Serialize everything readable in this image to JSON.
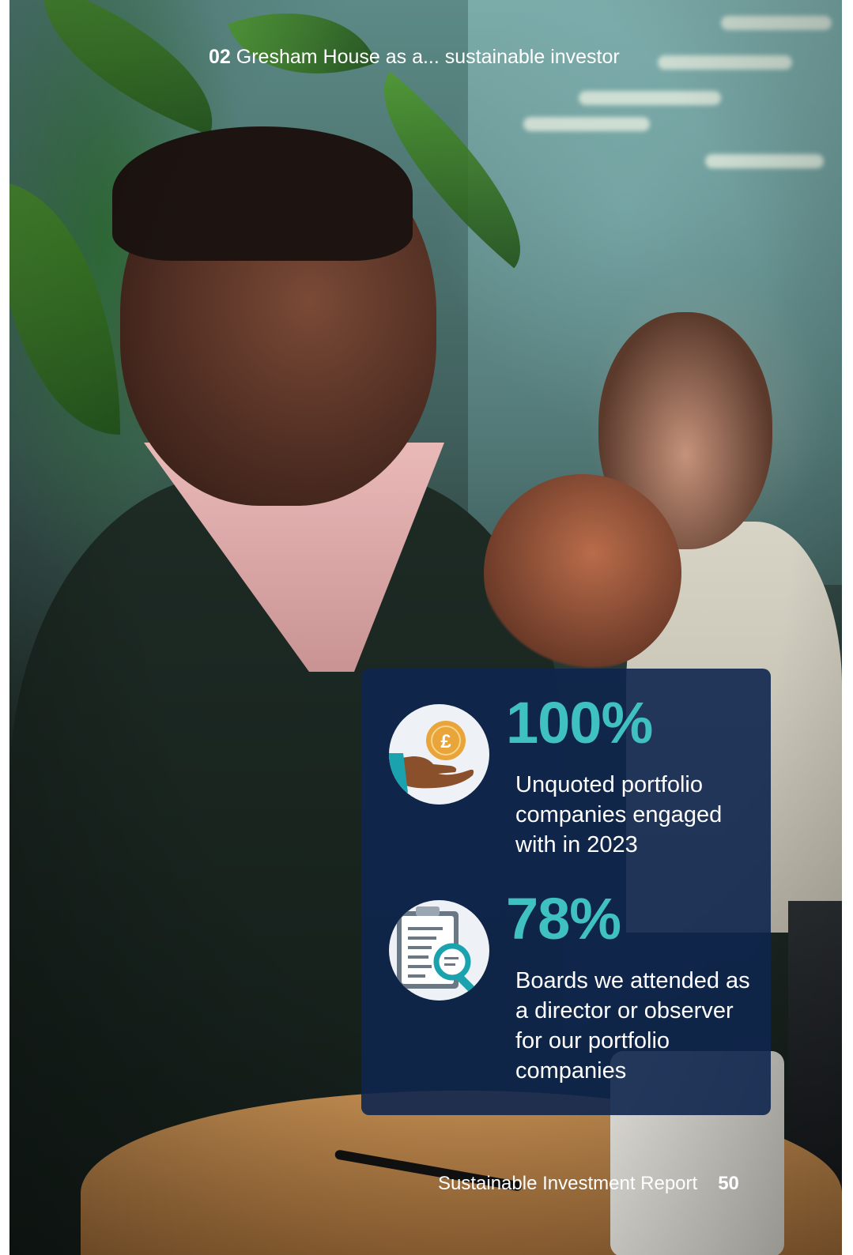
{
  "header": {
    "section_number": "02",
    "section_title": "Gresham House as a... sustainable investor"
  },
  "stats": [
    {
      "value": "100%",
      "description": "Unquoted portfolio companies engaged with in 2023",
      "icon": "coin-in-hand-icon"
    },
    {
      "value": "78%",
      "description": "Boards we attended as a director or observer for our portfolio companies",
      "icon": "clipboard-magnifier-icon"
    }
  ],
  "footer": {
    "report_title": "Sustainable Investment Report",
    "page_number": "50"
  },
  "colors": {
    "accent": "#3fc1c1",
    "panel": "#0e264e",
    "text": "#ffffff",
    "coin": "#e9a43a"
  }
}
